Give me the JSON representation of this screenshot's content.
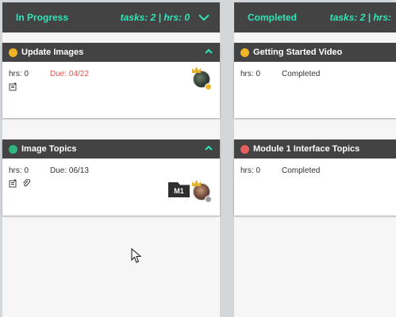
{
  "colors": {
    "header_bg": "#434343",
    "accent": "#2ee6b8",
    "column_bg": "#f6f6f6",
    "board_bg": "#d3d7da",
    "status_yellow": "#f0b429",
    "status_green": "#2fb67c",
    "status_red": "#e85d5d",
    "due_overdue": "#e5534b"
  },
  "columns": [
    {
      "title": "In Progress",
      "stats": "tasks: 2 | hrs: 0",
      "cards": [
        {
          "title": "Update Images",
          "status_color": "#f0b429",
          "hrs_label": "hrs: 0",
          "due_label": "Due: 04/22",
          "icons": [
            "description-icon"
          ],
          "avatar_badge_color": "#f0b429"
        },
        {
          "title": "Image Topics",
          "status_color": "#2fb67c",
          "hrs_label": "hrs: 0",
          "due_label": "Due: 06/13",
          "icons": [
            "description-icon",
            "attachment-icon"
          ],
          "module_tag": "M1",
          "avatar_badge_color": "#9a9a9a"
        }
      ]
    },
    {
      "title": "Completed",
      "stats": "tasks: 2 | hrs:",
      "cards": [
        {
          "title": "Getting Started Video",
          "status_color": "#f0b429",
          "hrs_label": "hrs: 0",
          "state_label": "Completed"
        },
        {
          "title": "Module 1 Interface Topics",
          "status_color": "#e85d5d",
          "hrs_label": "hrs: 0",
          "state_label": "Completed"
        }
      ]
    }
  ]
}
